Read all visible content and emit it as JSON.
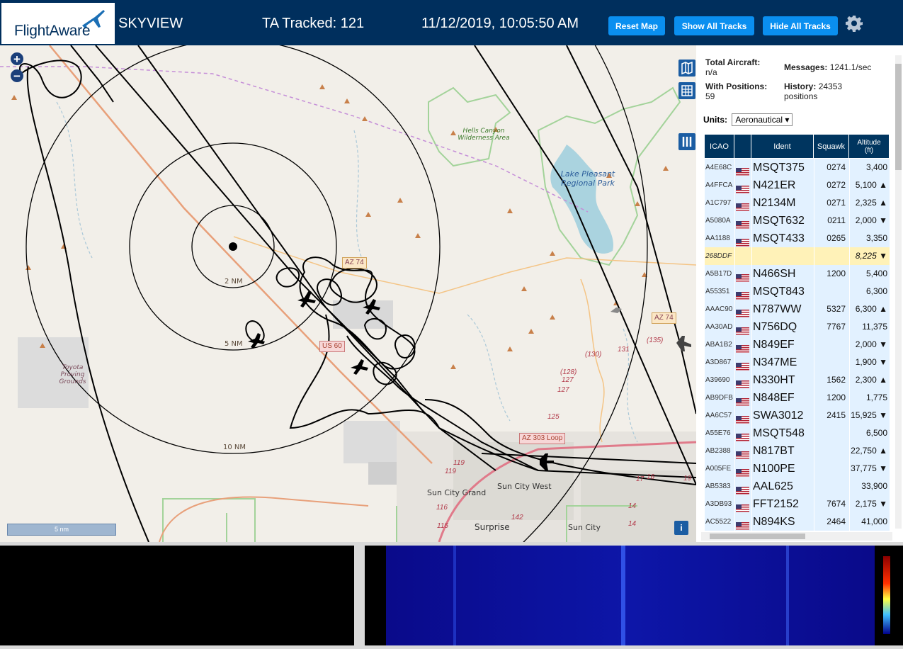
{
  "header": {
    "logo_text": "FlightAware",
    "app_name": "SKYVIEW",
    "tracked_label": "TA Tracked: 121",
    "datetime": "11/12/2019, 10:05:50 AM",
    "buttons": {
      "reset": "Reset Map",
      "show": "Show All Tracks",
      "hide": "Hide All Tracks"
    },
    "settings_icon": "gear-icon"
  },
  "map": {
    "zoom_in": "+",
    "zoom_out": "−",
    "rings": [
      "2 NM",
      "5 NM",
      "10 NM"
    ],
    "scale": "5 nm",
    "info": "i",
    "places": {
      "hells_canyon": "Hells Canyon Wilderness Area",
      "lake_pleasant": "Lake Pleasant Regional Park",
      "toyota": "Toyota Proving Grounds",
      "sun_city_grand": "Sun City Grand",
      "sun_city_west": "Sun City West",
      "surprise": "Surprise",
      "sun_city": "Sun City"
    },
    "roads": {
      "az74_top": "AZ 74",
      "az74_right": "AZ 74",
      "us60": "US 60",
      "az303": "AZ 303 Loop"
    },
    "road_numbers": [
      "(130)",
      "131",
      "(135)",
      "(128)",
      "127",
      "127",
      "125",
      "119",
      "119",
      "116",
      "115",
      "142",
      "17",
      "16",
      "19",
      "14",
      "14"
    ]
  },
  "panel": {
    "total_aircraft_label": "Total Aircraft:",
    "total_aircraft_value": "n/a",
    "messages_label": "Messages:",
    "messages_value": "1241.1/sec",
    "with_positions_label": "With Positions:",
    "with_positions_value": "59",
    "history_label": "History:",
    "history_value": "24353",
    "history_unit": "positions",
    "units_label": "Units:",
    "units_value": "Aeronautical ▾",
    "columns": [
      "ICAO",
      "",
      "Ident",
      "Squawk",
      "Altitude (ft)"
    ],
    "rows": [
      {
        "icao": "A4E68C",
        "ident": "MSQT375",
        "squawk": "0274",
        "alt": "3,400",
        "flag": true
      },
      {
        "icao": "A4FFCA",
        "ident": "N421ER",
        "squawk": "0272",
        "alt": "5,100 ▲",
        "flag": true
      },
      {
        "icao": "A1C797",
        "ident": "N2134M",
        "squawk": "0271",
        "alt": "2,325 ▲",
        "flag": true
      },
      {
        "icao": "A5080A",
        "ident": "MSQT632",
        "squawk": "0211",
        "alt": "2,000 ▼",
        "flag": true
      },
      {
        "icao": "AA1188",
        "ident": "MSQT433",
        "squawk": "0265",
        "alt": "3,350",
        "flag": true
      },
      {
        "icao": "268DDF",
        "ident": "",
        "squawk": "",
        "alt": "8,225 ▼",
        "flag": false,
        "selected": true
      },
      {
        "icao": "A5B17D",
        "ident": "N466SH",
        "squawk": "1200",
        "alt": "5,400",
        "flag": true
      },
      {
        "icao": "A55351",
        "ident": "MSQT843",
        "squawk": "",
        "alt": "6,300",
        "flag": true
      },
      {
        "icao": "AAAC90",
        "ident": "N787WW",
        "squawk": "5327",
        "alt": "6,300 ▲",
        "flag": true
      },
      {
        "icao": "AA30AD",
        "ident": "N756DQ",
        "squawk": "7767",
        "alt": "11,375",
        "flag": true
      },
      {
        "icao": "ABA1B2",
        "ident": "N849EF",
        "squawk": "",
        "alt": "2,000 ▼",
        "flag": true
      },
      {
        "icao": "A3D867",
        "ident": "N347ME",
        "squawk": "",
        "alt": "1,900 ▼",
        "flag": true
      },
      {
        "icao": "A39690",
        "ident": "N330HT",
        "squawk": "1562",
        "alt": "2,300 ▲",
        "flag": true
      },
      {
        "icao": "AB9DFB",
        "ident": "N848EF",
        "squawk": "1200",
        "alt": "1,775",
        "flag": true
      },
      {
        "icao": "AA6C57",
        "ident": "SWA3012",
        "squawk": "2415",
        "alt": "15,925 ▼",
        "flag": true
      },
      {
        "icao": "A55E76",
        "ident": "MSQT548",
        "squawk": "",
        "alt": "6,500",
        "flag": true
      },
      {
        "icao": "AB2388",
        "ident": "N817BT",
        "squawk": "",
        "alt": "22,750 ▲",
        "flag": true
      },
      {
        "icao": "A005FE",
        "ident": "N100PE",
        "squawk": "",
        "alt": "37,775 ▼",
        "flag": true
      },
      {
        "icao": "AB5383",
        "ident": "AAL625",
        "squawk": "",
        "alt": "33,900",
        "flag": true
      },
      {
        "icao": "A3DB93",
        "ident": "FFT2152",
        "squawk": "7674",
        "alt": "2,175 ▼",
        "flag": true
      },
      {
        "icao": "AC5522",
        "ident": "N894KS",
        "squawk": "2464",
        "alt": "41,000",
        "flag": true
      }
    ]
  },
  "colors": {
    "header_bg": "#002f5d",
    "button": "#0a8ff0",
    "table_header": "#00355f",
    "row": "#e2f1ff",
    "row_selected": "#fff2b8"
  }
}
